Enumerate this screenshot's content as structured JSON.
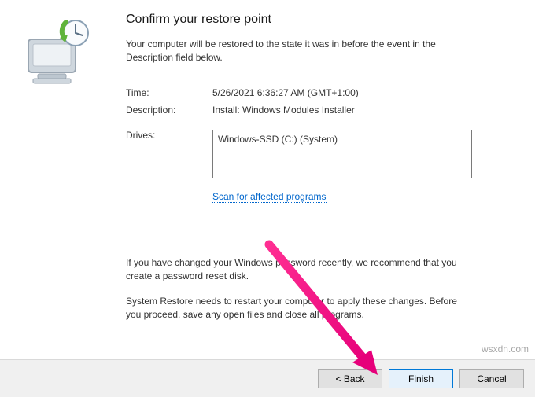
{
  "title": "Confirm your restore point",
  "intro": "Your computer will be restored to the state it was in before the event in the Description field below.",
  "labels": {
    "time": "Time:",
    "description": "Description:",
    "drives": "Drives:"
  },
  "values": {
    "time": "5/26/2021 6:36:27 AM (GMT+1:00)",
    "description": "Install: Windows Modules Installer",
    "drive_item": "Windows-SSD (C:) (System)"
  },
  "scan_link": "Scan for affected programs",
  "note_password": "If you have changed your Windows password recently, we recommend that you create a password reset disk.",
  "note_restart": "System Restore needs to restart your computer to apply these changes. Before you proceed, save any open files and close all programs.",
  "buttons": {
    "back": "< Back",
    "finish": "Finish",
    "cancel": "Cancel"
  },
  "watermark": "wsxdn.com"
}
